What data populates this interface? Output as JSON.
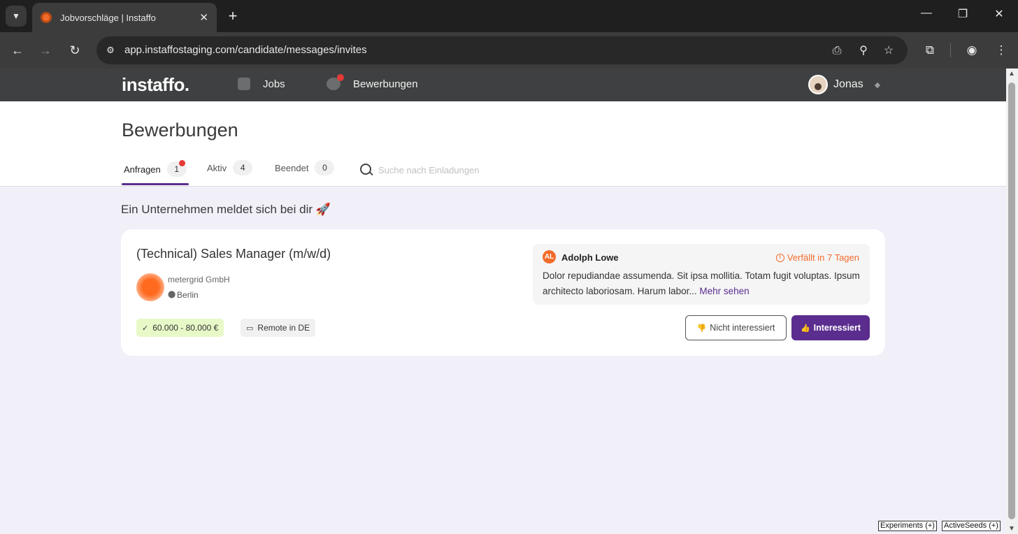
{
  "browser": {
    "tab_title": "Jobvorschläge | Instaffo",
    "url": "app.instaffostaging.com/candidate/messages/invites"
  },
  "header": {
    "logo": "instaffo.",
    "nav": [
      {
        "label": "Jobs"
      },
      {
        "label": "Bewerbungen"
      }
    ],
    "user_name": "Jonas"
  },
  "page": {
    "title": "Bewerbungen",
    "tabs": [
      {
        "label": "Anfragen",
        "count": "1"
      },
      {
        "label": "Aktiv",
        "count": "4"
      },
      {
        "label": "Beendet",
        "count": "0"
      }
    ],
    "search_placeholder": "Suche nach Einladungen"
  },
  "content": {
    "section_title": "Ein Unternehmen meldet sich bei dir 🚀",
    "card": {
      "job_title": "(Technical) Sales Manager (m/w/d)",
      "company": "metergrid GmbH",
      "location": "Berlin",
      "salary": "60.000 - 80.000 €",
      "remote": "Remote in DE",
      "sender_initials": "AL",
      "sender_name": "Adolph Lowe",
      "expires": "Verfällt in 7 Tagen",
      "message": "Dolor repudiandae assumenda. Sit ipsa mollitia. Totam fugit voluptas. Ipsum architecto laboriosam. Harum labor...",
      "more_link": "Mehr sehen",
      "decline_label": "Nicht interessiert",
      "accept_label": "Interessiert"
    }
  },
  "debug": {
    "experiments": "Experiments (+)",
    "active_seeds": "ActiveSeeds (+)"
  },
  "colors": {
    "brand_purple": "#5b2d8e",
    "accent_orange": "#f26b2a",
    "header_bg": "#3f4041",
    "page_bg": "#f1eff8"
  }
}
